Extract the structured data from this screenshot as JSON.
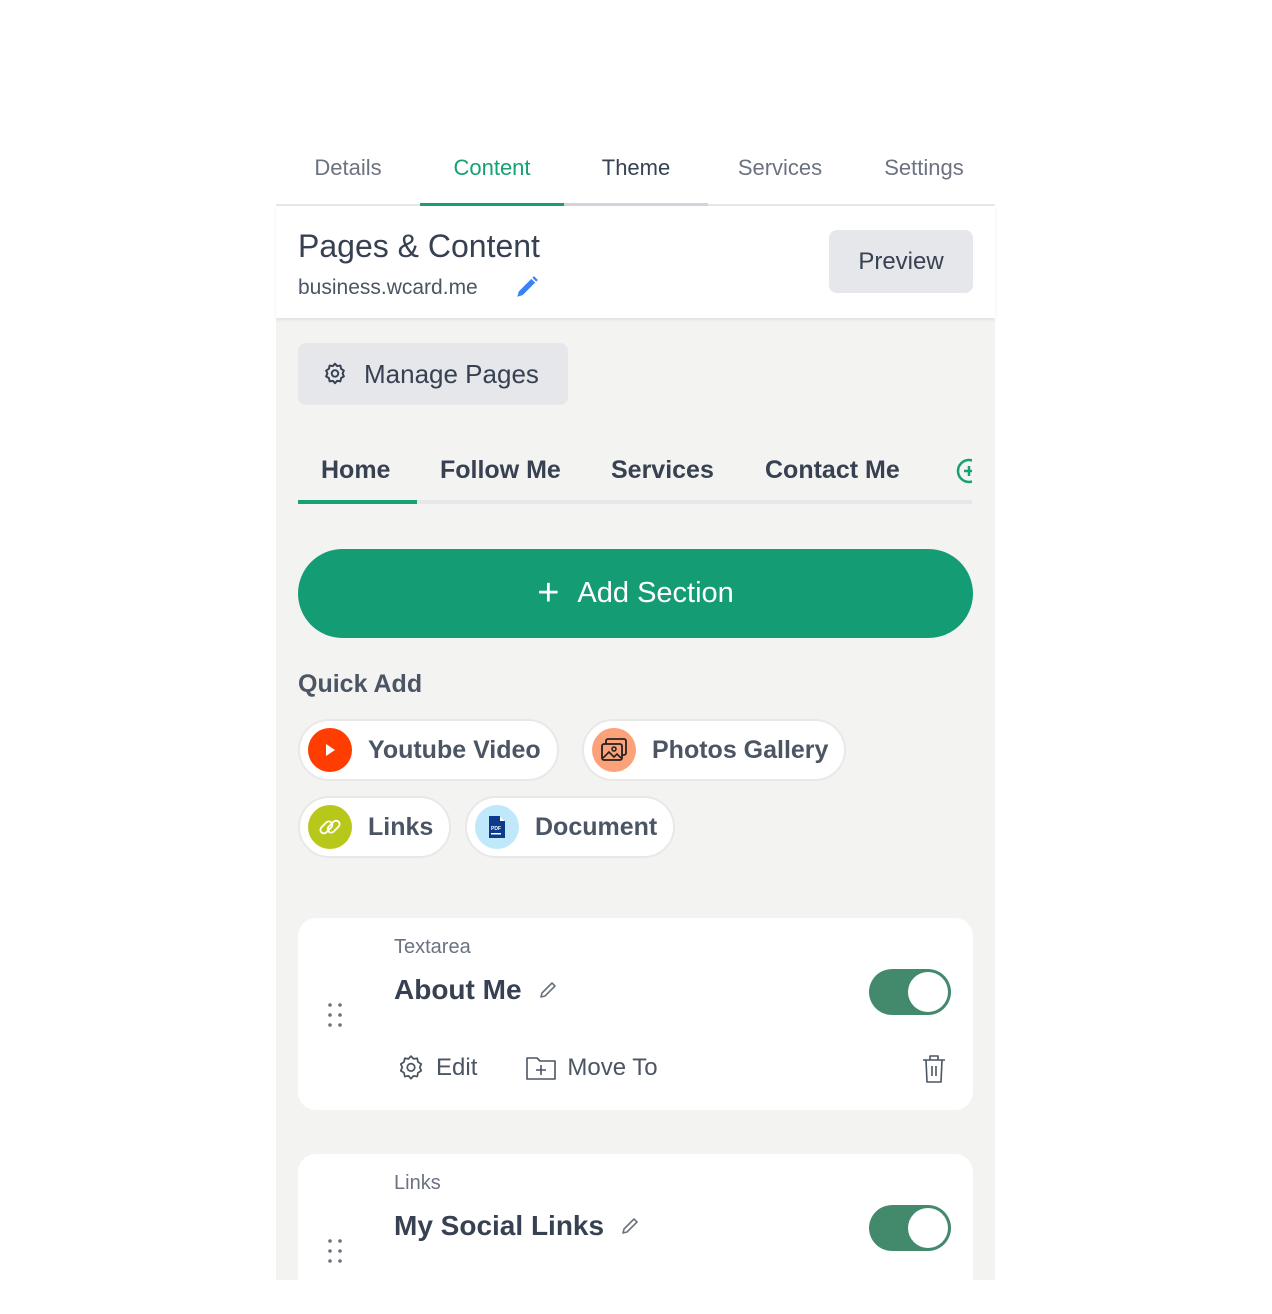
{
  "top_tabs": [
    {
      "label": "Details",
      "state": "inactive"
    },
    {
      "label": "Content",
      "state": "active"
    },
    {
      "label": "Theme",
      "state": "hover"
    },
    {
      "label": "Services",
      "state": "inactive"
    },
    {
      "label": "Settings",
      "state": "inactive"
    }
  ],
  "header": {
    "title": "Pages & Content",
    "domain": "business.wcard.me",
    "preview_label": "Preview"
  },
  "manage_pages_label": "Manage Pages",
  "page_tabs": [
    {
      "label": "Home",
      "active": true
    },
    {
      "label": "Follow Me",
      "active": false
    },
    {
      "label": "Services",
      "active": false
    },
    {
      "label": "Contact Me",
      "active": false
    }
  ],
  "add_section_label": "Add Section",
  "quick_add": {
    "label": "Quick Add",
    "items": [
      {
        "label": "Youtube Video",
        "icon": "youtube-play-icon",
        "color": "#ff3d00"
      },
      {
        "label": "Photos Gallery",
        "icon": "photos-gallery-icon",
        "color": "#fca27a"
      },
      {
        "label": "Links",
        "icon": "link-icon",
        "color": "#b8c81b"
      },
      {
        "label": "Document",
        "icon": "pdf-document-icon",
        "color": "#bfe9fb"
      }
    ]
  },
  "sections": [
    {
      "type": "Textarea",
      "title": "About Me",
      "enabled": true,
      "actions": {
        "edit": "Edit",
        "move": "Move To"
      }
    },
    {
      "type": "Links",
      "title": "My Social Links",
      "enabled": true
    }
  ],
  "colors": {
    "accent": "#16a074",
    "toggle_on": "#438a6d"
  }
}
